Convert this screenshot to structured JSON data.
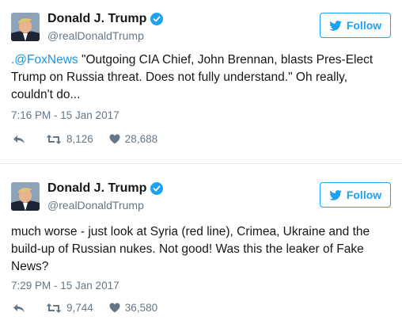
{
  "tweets": [
    {
      "author": {
        "name": "Donald J. Trump",
        "handle": "@realDonaldTrump",
        "verified": true
      },
      "follow_label": "Follow",
      "mention": ".@FoxNews",
      "text": " \"Outgoing CIA Chief, John Brennan, blasts Pres-Elect Trump on Russia threat. Does not fully understand.\" Oh really, couldn't do...",
      "timestamp": "7:16 PM - 15 Jan 2017",
      "retweets": "8,126",
      "likes": "28,688"
    },
    {
      "author": {
        "name": "Donald J. Trump",
        "handle": "@realDonaldTrump",
        "verified": true
      },
      "follow_label": "Follow",
      "mention": "",
      "text": "much worse - just look at Syria (red line), Crimea, Ukraine and the build-up of Russian nukes. Not good! Was this the leaker of Fake News?",
      "timestamp": "7:29 PM - 15 Jan 2017",
      "retweets": "9,744",
      "likes": "36,580"
    }
  ],
  "colors": {
    "accent": "#1da1f2",
    "link": "#1b95e0",
    "muted": "#657786",
    "divider": "#e1e8ed"
  },
  "icons": [
    "bird-icon",
    "verified-badge-icon",
    "reply-icon",
    "retweet-icon",
    "heart-icon"
  ]
}
